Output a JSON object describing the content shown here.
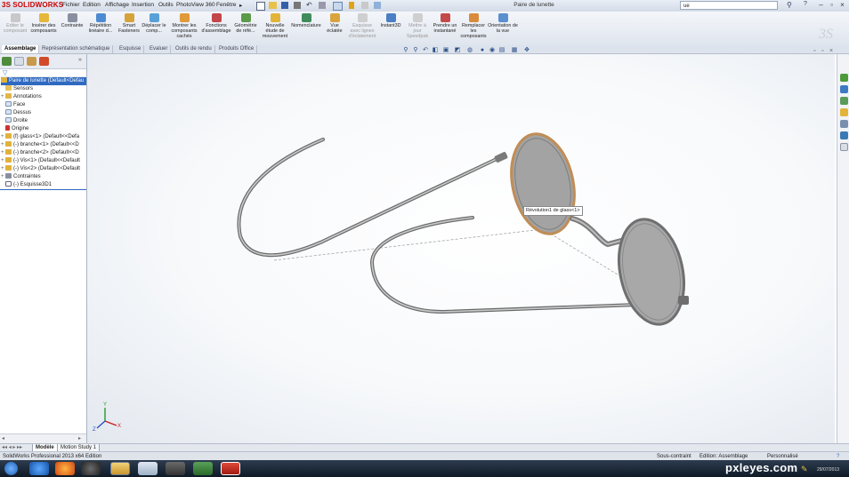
{
  "app": {
    "logo": "SOLIDWORKS",
    "window_title": "Paire de lunette",
    "search_value": "ue"
  },
  "menu": [
    "Fichier",
    "Edition",
    "Affichage",
    "Insertion",
    "Outils",
    "PhotoView 360",
    "Fenêtre"
  ],
  "commands": [
    {
      "label": "Editer le composant",
      "disabled": true
    },
    {
      "label": "Insérer des composants",
      "disabled": false
    },
    {
      "label": "Contrainte",
      "disabled": false
    },
    {
      "label": "Répétition linéaire d...",
      "disabled": false
    },
    {
      "label": "Smart Fasteners",
      "disabled": false
    },
    {
      "label": "Déplacer le comp...",
      "disabled": false
    },
    {
      "label": "Montrer les composants cachés",
      "disabled": false
    },
    {
      "label": "Fonctions d'assemblage",
      "disabled": false
    },
    {
      "label": "Géométrie de réfé...",
      "disabled": false
    },
    {
      "label": "Nouvelle étude de mouvement",
      "disabled": false
    },
    {
      "label": "Nomenclature",
      "disabled": false
    },
    {
      "label": "Vue éclatée",
      "disabled": false
    },
    {
      "label": "Esquisse avec lignes d'éclatement",
      "disabled": true
    },
    {
      "label": "Instant3D",
      "disabled": false
    },
    {
      "label": "Mettre à jour Speedpak",
      "disabled": true
    },
    {
      "label": "Prendre un instantané",
      "disabled": false
    },
    {
      "label": "Remplacer les composants",
      "disabled": false
    },
    {
      "label": "Orientation de la vue",
      "disabled": false
    }
  ],
  "tabs": [
    "Assemblage",
    "Représentation schématique",
    "Esquisse",
    "Evaluer",
    "Outils de rendu",
    "Produits Office"
  ],
  "tree": {
    "root": "Paire de lunette  (Default<Defau",
    "items": [
      {
        "label": "Sensors",
        "pm": ""
      },
      {
        "label": "Annotations",
        "pm": "+"
      },
      {
        "label": "Face",
        "pm": ""
      },
      {
        "label": "Dessus",
        "pm": ""
      },
      {
        "label": "Droite",
        "pm": ""
      },
      {
        "label": "Origine",
        "pm": ""
      },
      {
        "label": "(f) glass<1> (Default<<Defa",
        "pm": "+"
      },
      {
        "label": "(-) branche<1> (Default<<D",
        "pm": "+"
      },
      {
        "label": "(-) branche<2> (Default<<D",
        "pm": "+"
      },
      {
        "label": "(-) Vis<1> (Default<<Default",
        "pm": "+"
      },
      {
        "label": "(-) Vis<2> (Default<<Default",
        "pm": "+"
      },
      {
        "label": "Contraintes",
        "pm": "+"
      },
      {
        "label": "(-) Esquisse3D1",
        "pm": ""
      }
    ]
  },
  "tooltip": "Révolution1 de glass<1>",
  "bottom_tabs": [
    "Modèle",
    "Motion Study 1"
  ],
  "status": {
    "product": "SolidWorks Professional 2013 x64 Edition",
    "constraint": "Sous-contraint",
    "mode": "Edition: Assemblage",
    "custom": "Personnalisé"
  },
  "watermark": "pxleyes.com",
  "clock": "29/07/2013",
  "colors": {
    "accent": "#2f6ac1",
    "logo_red": "#cc0000",
    "lens": "#9a9a9a"
  }
}
